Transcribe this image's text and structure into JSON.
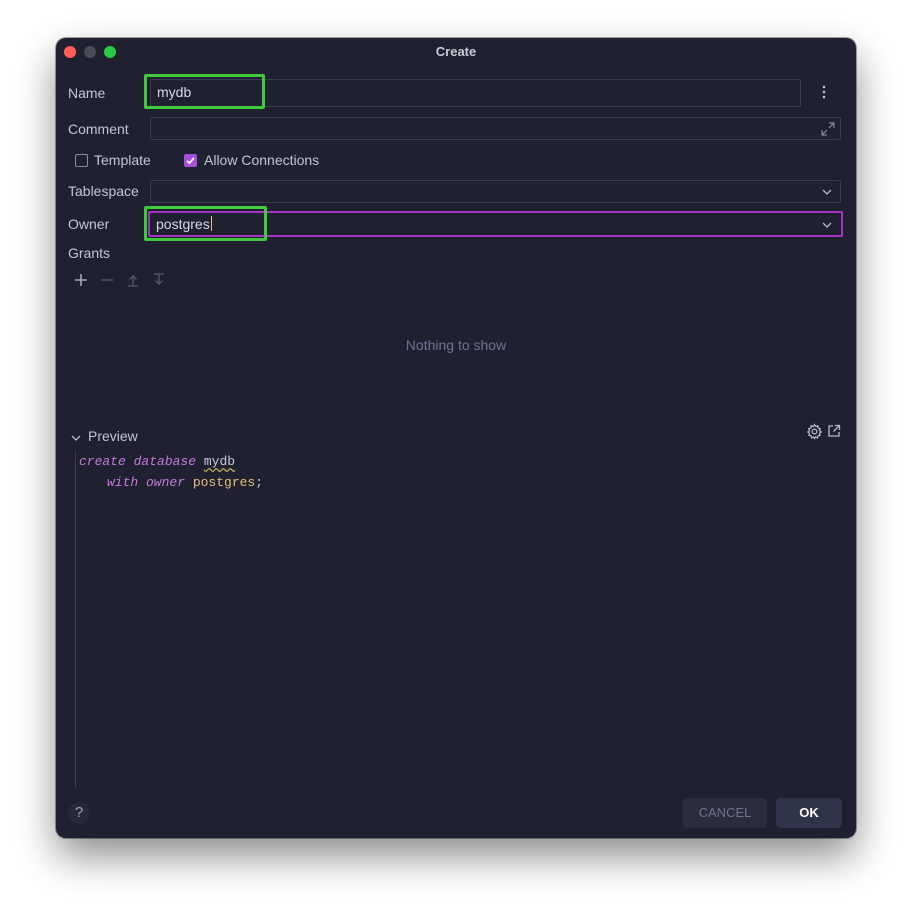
{
  "window": {
    "title": "Create"
  },
  "form": {
    "name_label": "Name",
    "name_value": "mydb",
    "comment_label": "Comment",
    "comment_value": "",
    "template_label": "Template",
    "template_checked": false,
    "allow_connections_label": "Allow Connections",
    "allow_connections_checked": true,
    "tablespace_label": "Tablespace",
    "tablespace_value": "",
    "owner_label": "Owner",
    "owner_value": "postgres"
  },
  "grants": {
    "label": "Grants",
    "empty_text": "Nothing to show"
  },
  "preview": {
    "label": "Preview",
    "line1_kw": "create database",
    "line1_ident": "mydb",
    "line2_kw": "with owner",
    "line2_owner": "postgres",
    "line2_punct": ";"
  },
  "footer": {
    "help_label": "?",
    "cancel_label": "CANCEL",
    "ok_label": "OK"
  },
  "icons": {
    "more": "more-vertical-icon",
    "expand": "expand-icon",
    "dropdown": "chevron-down-icon",
    "add": "plus-icon",
    "remove": "minus-icon",
    "move_up": "move-up-icon",
    "move_down": "move-down-icon",
    "settings": "gear-icon",
    "open_external": "open-external-icon"
  },
  "colors": {
    "accent_purple": "#a335c2",
    "highlight_green": "#3ecb3b",
    "keyword": "#c678dd",
    "string": "#e5c07b"
  }
}
